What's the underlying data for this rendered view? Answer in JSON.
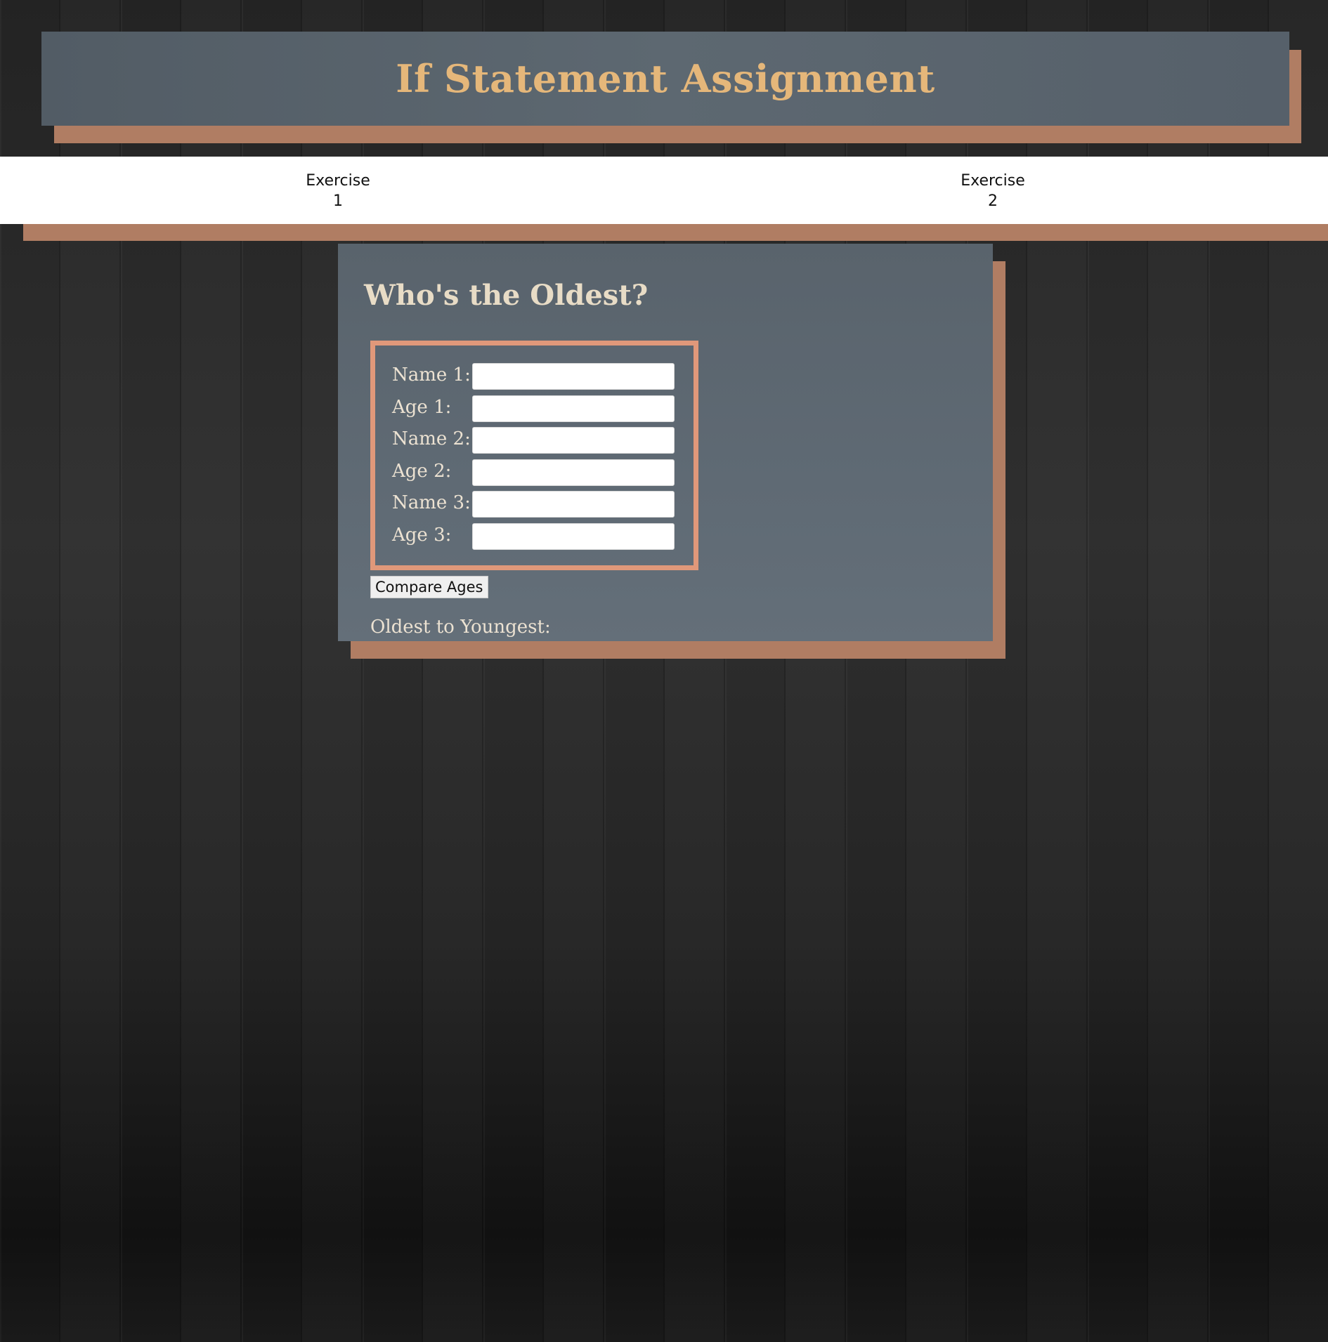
{
  "header": {
    "title": "If Statement Assignment"
  },
  "nav": {
    "items": [
      {
        "line1": "Exercise",
        "line2": "1"
      },
      {
        "line1": "Exercise",
        "line2": "2"
      }
    ]
  },
  "panel": {
    "title": "Who's the Oldest?",
    "fields": [
      {
        "label": "Name 1:",
        "value": ""
      },
      {
        "label": "Age 1:",
        "value": ""
      },
      {
        "label": "Name 2:",
        "value": ""
      },
      {
        "label": "Age 2:",
        "value": ""
      },
      {
        "label": "Name 3:",
        "value": ""
      },
      {
        "label": "Age 3:",
        "value": ""
      }
    ],
    "button_label": "Compare Ages",
    "result_label": "Oldest to Youngest:"
  },
  "colors": {
    "accent": "#b07d63",
    "form_border": "#e0987a",
    "title": "#e5b77a",
    "panel": "#5d6871"
  }
}
